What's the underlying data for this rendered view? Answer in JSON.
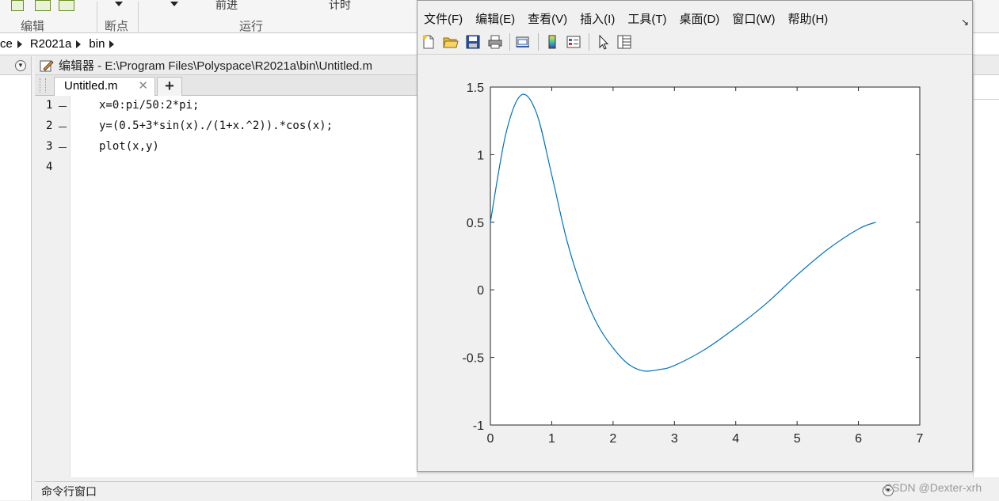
{
  "ribbon": {
    "sections": [
      "编辑",
      "断点",
      "运行"
    ],
    "advance_label": "前进",
    "timer_label": "计时"
  },
  "address": {
    "crumbs": [
      "ce",
      "R2021a",
      "bin"
    ]
  },
  "editor": {
    "title": "编辑器 - E:\\Program Files\\Polyspace\\R2021a\\bin\\Untitled.m",
    "tab_label": "Untitled.m",
    "tab_close": "✕",
    "add_tab": "+",
    "lines": [
      {
        "num": "1",
        "code": "x=0:pi/50:2*pi;"
      },
      {
        "num": "2",
        "code": "y=(0.5+3*sin(x)./(1+x.^2)).*cos(x);"
      },
      {
        "num": "3",
        "code": "plot(x,y)"
      },
      {
        "num": "4",
        "code": ""
      }
    ]
  },
  "command_window": {
    "label": "命令行窗口"
  },
  "watermark": "CSDN @Dexter-xrh",
  "figure": {
    "menu": [
      "文件(F)",
      "编辑(E)",
      "查看(V)",
      "插入(I)",
      "工具(T)",
      "桌面(D)",
      "窗口(W)",
      "帮助(H)"
    ],
    "dock_icon": "↘",
    "toolbar_icons": [
      "new-figure-icon",
      "open-file-icon",
      "save-icon",
      "print-icon",
      "link-plot-icon",
      "colorbar-icon",
      "legend-icon",
      "pointer-icon",
      "property-inspector-icon"
    ],
    "line_color": "#0072bd"
  },
  "chart_data": {
    "type": "line",
    "title": "",
    "xlabel": "",
    "ylabel": "",
    "xlim": [
      0,
      7
    ],
    "ylim": [
      -1,
      1.5
    ],
    "xticks": [
      "0",
      "1",
      "2",
      "3",
      "4",
      "5",
      "6",
      "7"
    ],
    "yticks": [
      "-1",
      "-0.5",
      "0",
      "0.5",
      "1",
      "1.5"
    ],
    "grid": false,
    "series": [
      {
        "x": [
          0,
          0.25,
          0.5,
          0.75,
          1.0,
          1.25,
          1.5,
          1.75,
          2.0,
          2.25,
          2.5,
          2.75,
          3.0,
          3.5,
          4.0,
          4.5,
          5.0,
          5.5,
          6.0,
          6.283
        ],
        "y": [
          0.5,
          1.15,
          1.44,
          1.31,
          0.85,
          0.36,
          0.0,
          -0.26,
          -0.43,
          -0.55,
          -0.6,
          -0.59,
          -0.56,
          -0.44,
          -0.28,
          -0.1,
          0.11,
          0.3,
          0.45,
          0.5
        ]
      }
    ]
  }
}
